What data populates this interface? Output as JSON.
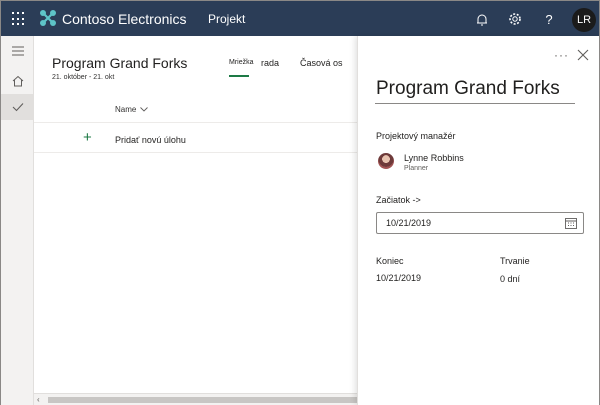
{
  "header": {
    "brand": "Contoso Electronics",
    "app_name": "Projekt",
    "user_initials": "LR",
    "icons": [
      "waffle-icon",
      "bell-icon",
      "gear-icon",
      "help-icon"
    ]
  },
  "plan": {
    "title": "Program Grand Forks",
    "dates": "21. október - 21. okt",
    "tabs": [
      "Mriežka",
      "rada",
      "Časová os"
    ],
    "active_tab": "Mriežka",
    "column_name": "Name",
    "add_task_label": "Pridať novú úlohu"
  },
  "panel": {
    "title": "Program Grand Forks",
    "manager_label": "Projektový manažér",
    "manager_name": "Lynne Robbins",
    "manager_sub": "Planner",
    "start_label": "Začiatok ->",
    "start_value": "10/21/2019",
    "end_label": "Koniec",
    "end_value": "10/21/2019",
    "duration_label": "Trvanie",
    "duration_value": "0 dní"
  },
  "colors": {
    "topbar": "#2b3d57",
    "accent": "#1d7a45",
    "logo": "#5ec4c8"
  }
}
